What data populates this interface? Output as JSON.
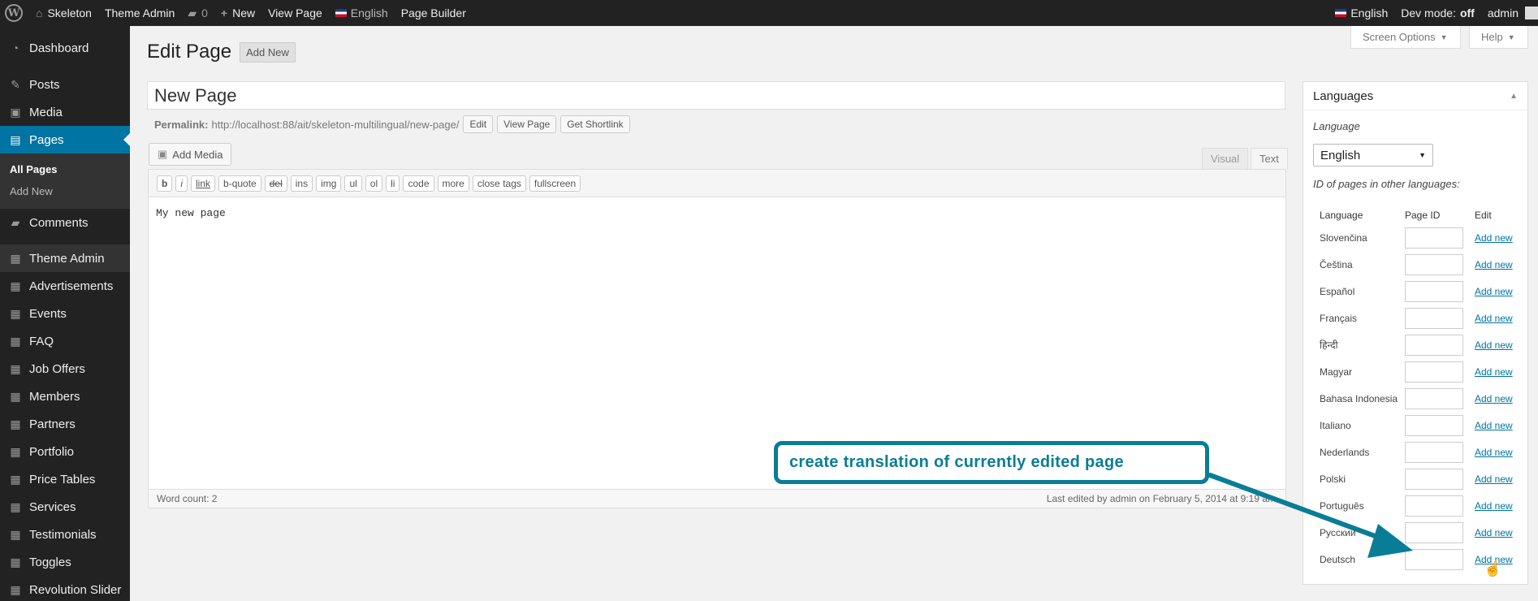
{
  "adminbar": {
    "left": [
      {
        "icon": "wordpress-icon",
        "label": ""
      },
      {
        "icon": "home-icon",
        "label": "Skeleton"
      },
      {
        "icon": "",
        "label": "Theme Admin"
      },
      {
        "icon": "comment-icon",
        "label": "0"
      },
      {
        "icon": "plus-icon",
        "label": "New"
      },
      {
        "icon": "",
        "label": "View Page"
      },
      {
        "icon": "flag-icon",
        "label": "English"
      },
      {
        "icon": "",
        "label": "Page Builder"
      }
    ],
    "right_language": "English",
    "dev_mode_label": "Dev mode:",
    "dev_mode_value": "off",
    "user": "admin"
  },
  "sidebar": {
    "dashboard": "Dashboard",
    "posts": "Posts",
    "media": "Media",
    "pages": "Pages",
    "pages_sub": [
      "All Pages",
      "Add New"
    ],
    "comments": "Comments",
    "theme_items": [
      "Theme Admin",
      "Advertisements",
      "Events",
      "FAQ",
      "Job Offers",
      "Members",
      "Partners",
      "Portfolio",
      "Price Tables",
      "Services",
      "Testimonials",
      "Toggles",
      "Revolution Slider"
    ]
  },
  "screen_options": "Screen Options",
  "help": "Help",
  "heading": {
    "title": "Edit Page",
    "add_new": "Add New"
  },
  "title_value": "New Page",
  "permalink": {
    "label": "Permalink:",
    "url": "http://localhost:88/ait/skeleton-multilingual/new-page/",
    "edit": "Edit",
    "view": "View Page",
    "shortlink": "Get Shortlink"
  },
  "editor": {
    "add_media": "Add Media",
    "tab_visual": "Visual",
    "tab_text": "Text",
    "quicktags": [
      "b",
      "i",
      "link",
      "b-quote",
      "del",
      "ins",
      "img",
      "ul",
      "ol",
      "li",
      "code",
      "more",
      "close tags",
      "fullscreen"
    ],
    "content": "My new page",
    "word_count": "Word count: 2",
    "last_edited": "Last edited by admin on February 5, 2014 at 9:19 am"
  },
  "languages_box": {
    "title": "Languages",
    "language_label": "Language",
    "selected_language": "English",
    "other_ids_label": "ID of pages in other languages:",
    "columns": [
      "Language",
      "Page ID",
      "Edit"
    ],
    "rows": [
      {
        "language": "Slovenčina",
        "action": "Add new"
      },
      {
        "language": "Čeština",
        "action": "Add new"
      },
      {
        "language": "Español",
        "action": "Add new"
      },
      {
        "language": "Français",
        "action": "Add new"
      },
      {
        "language": "हिन्दी",
        "action": "Add new"
      },
      {
        "language": "Magyar",
        "action": "Add new"
      },
      {
        "language": "Bahasa Indonesia",
        "action": "Add new"
      },
      {
        "language": "Italiano",
        "action": "Add new"
      },
      {
        "language": "Nederlands",
        "action": "Add new"
      },
      {
        "language": "Polski",
        "action": "Add new"
      },
      {
        "language": "Português",
        "action": "Add new"
      },
      {
        "language": "Русский",
        "action": "Add new"
      },
      {
        "language": "Deutsch",
        "action": "Add new"
      }
    ]
  },
  "callout": "create translation of currently edited page",
  "colors": {
    "accent": "#0074a2",
    "callout": "#0a7d96",
    "adminbar": "#222222"
  }
}
